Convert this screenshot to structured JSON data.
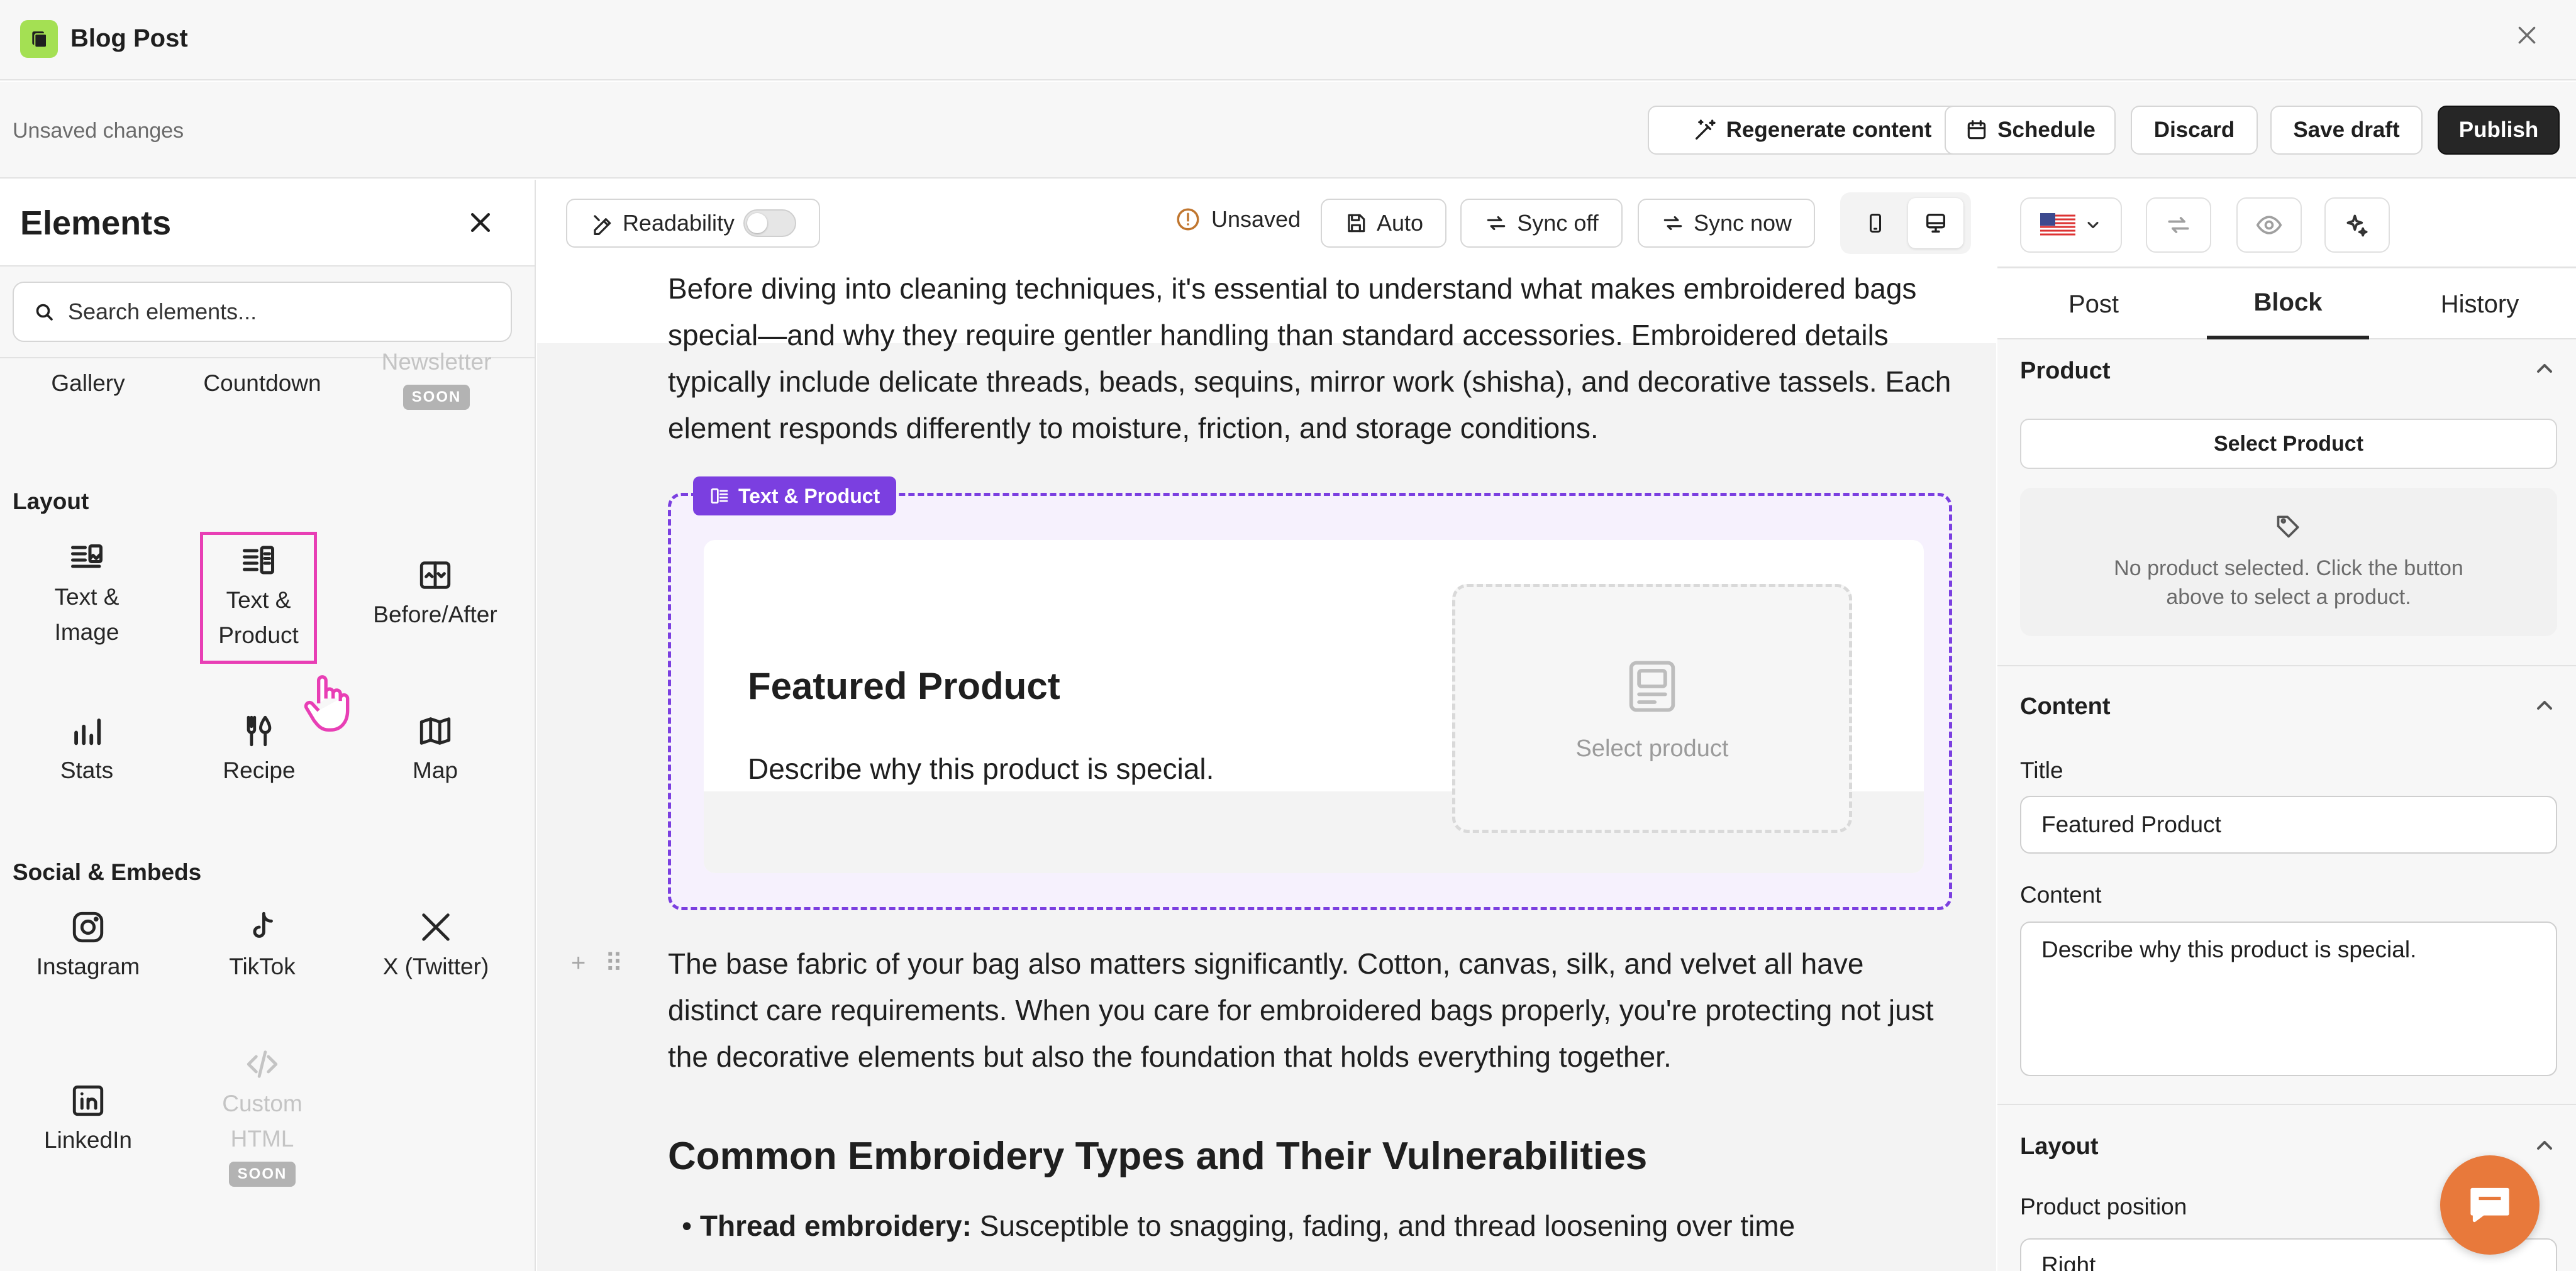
{
  "window": {
    "title": "Blog Post",
    "close_icon": "close-icon"
  },
  "topbar": {
    "status": "Unsaved changes",
    "regenerate_label": "Regenerate content",
    "schedule_label": "Schedule",
    "discard_label": "Discard",
    "save_draft_label": "Save draft",
    "publish_label": "Publish"
  },
  "sidebar": {
    "title": "Elements",
    "search_placeholder": "Search elements...",
    "top_items": [
      {
        "label": "Gallery"
      },
      {
        "label": "Countdown"
      },
      {
        "label": "Newsletter",
        "badge": "SOON"
      }
    ],
    "layout_title": "Layout",
    "layout_items": [
      {
        "label": "Text & Image",
        "icon": "text-image-icon"
      },
      {
        "label": "Text & Product",
        "icon": "text-product-icon"
      },
      {
        "label": "Before/After",
        "icon": "before-after-icon"
      },
      {
        "label": "Stats",
        "icon": "stats-icon"
      },
      {
        "label": "Recipe",
        "icon": "recipe-icon"
      },
      {
        "label": "Map",
        "icon": "map-icon"
      }
    ],
    "social_title": "Social & Embeds",
    "social_items": [
      {
        "label": "Instagram",
        "icon": "instagram-icon"
      },
      {
        "label": "TikTok",
        "icon": "tiktok-icon"
      },
      {
        "label": "X (Twitter)",
        "icon": "x-twitter-icon"
      },
      {
        "label": "LinkedIn",
        "icon": "linkedin-icon"
      },
      {
        "label": "Custom HTML",
        "icon": "code-icon",
        "badge": "SOON"
      }
    ]
  },
  "editor": {
    "readability_label": "Readability",
    "unsaved_label": "Unsaved",
    "auto_label": "Auto",
    "sync_off_label": "Sync off",
    "sync_now_label": "Sync now",
    "paragraph1": "Before diving into cleaning techniques, it's essential to understand what makes embroidered bags special—and why they require gentler handling than standard accessories. Embroidered details typically include delicate threads, beads, sequins, mirror work (shisha), and decorative tassels. Each element responds differently to moisture, friction, and storage conditions.",
    "block_tag": "Text & Product",
    "block_title": "Featured Product",
    "block_text": "Describe why this product is special.",
    "select_product": "Select product",
    "paragraph2": "The base fabric of your bag also matters significantly. Cotton, canvas, silk, and velvet all have distinct care requirements. When you care for embroidered bags properly, you're protecting not just the decorative elements but also the foundation that holds everything together.",
    "heading2": "Common Embroidery Types and Their Vulnerabilities",
    "bullet1_bold": "Thread embroidery:",
    "bullet1_text": " Susceptible to snagging, fading, and thread loosening over time"
  },
  "right_panel": {
    "tabs": [
      "Post",
      "Block",
      "History"
    ],
    "active_tab": "Block",
    "product_section": "Product",
    "select_product_btn": "Select Product",
    "no_product_text": "No product selected. Click the button above to select a product.",
    "content_section": "Content",
    "title_label": "Title",
    "title_value": "Featured Product",
    "content_label": "Content",
    "content_value": "Describe why this product is special.",
    "layout_section": "Layout",
    "product_position_label": "Product position",
    "product_position_value": "Right"
  },
  "colors": {
    "accent": "#7b3fe0",
    "brand": "#a4e053",
    "chat": "#e8793b",
    "highlight": "#e83fb5"
  }
}
